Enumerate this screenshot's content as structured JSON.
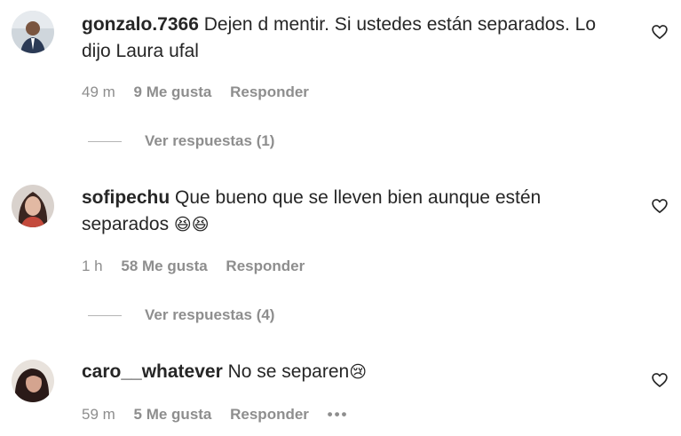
{
  "comments": [
    {
      "username": "gonzalo.7366",
      "text": "Dejen d mentir. Si ustedes están separados. Lo dijo Laura ufal",
      "time": "49 m",
      "likes": "9 Me gusta",
      "reply": "Responder",
      "view_replies": "Ver respuestas (1)"
    },
    {
      "username": "sofipechu",
      "text": "Que bueno que se lleven bien aunque estén separados",
      "emoji": "😆😆",
      "time": "1 h",
      "likes": "58 Me gusta",
      "reply": "Responder",
      "view_replies": "Ver respuestas (4)"
    },
    {
      "username": "caro__whatever",
      "text": "No se separen",
      "emoji": "😢",
      "time": "59 m",
      "likes": "5 Me gusta",
      "reply": "Responder",
      "more": "•••"
    }
  ],
  "icons": {
    "like": "heart-outline-icon",
    "more": "more-options-icon"
  }
}
